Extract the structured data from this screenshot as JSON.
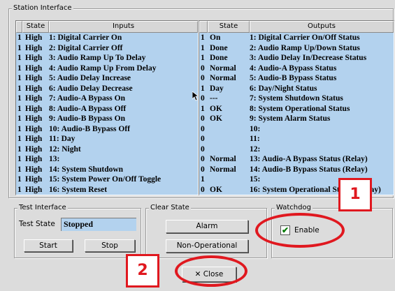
{
  "station": {
    "title": "Station Interface",
    "inputs": {
      "headers": [
        "State",
        "Inputs"
      ],
      "rows": [
        [
          "1",
          "High",
          "1: Digital Carrier On"
        ],
        [
          "1",
          "High",
          "2: Digital Carrier Off"
        ],
        [
          "1",
          "High",
          "3: Audio Ramp Up To Delay"
        ],
        [
          "1",
          "High",
          "4: Audio Ramp Up From Delay"
        ],
        [
          "1",
          "High",
          "5: Audio Delay Increase"
        ],
        [
          "1",
          "High",
          "6: Audio Delay Decrease"
        ],
        [
          "1",
          "High",
          "7: Audio-A Bypass On"
        ],
        [
          "1",
          "High",
          "8: Audio-A Bypass Off"
        ],
        [
          "1",
          "High",
          "9: Audio-B Bypass On"
        ],
        [
          "1",
          "High",
          "10: Audio-B Bypass Off"
        ],
        [
          "1",
          "High",
          "11: Day"
        ],
        [
          "1",
          "High",
          "12: Night"
        ],
        [
          "1",
          "High",
          "13:"
        ],
        [
          "1",
          "High",
          "14: System Shutdown"
        ],
        [
          "1",
          "High",
          "15: System Power On/Off Toggle"
        ],
        [
          "1",
          "High",
          "16: System Reset"
        ]
      ]
    },
    "outputs": {
      "headers": [
        "State",
        "Outputs"
      ],
      "rows": [
        [
          "1",
          "On",
          "1: Digital Carrier On/Off Status"
        ],
        [
          "1",
          "Done",
          "2: Audio Ramp Up/Down Status"
        ],
        [
          "1",
          "Done",
          "3: Audio Delay In/Decrease Status"
        ],
        [
          "0",
          "Normal",
          "4: Audio-A Bypass Status"
        ],
        [
          "0",
          "Normal",
          "5: Audio-B Bypass Status"
        ],
        [
          "1",
          "Day",
          "6: Day/Night Status"
        ],
        [
          "0",
          "---",
          "7: System Shutdown Status"
        ],
        [
          "1",
          "OK",
          "8: System Operational Status"
        ],
        [
          "0",
          "OK",
          "9: System Alarm Status"
        ],
        [
          "0",
          "",
          "10:"
        ],
        [
          "0",
          "",
          "11:"
        ],
        [
          "0",
          "",
          "12:"
        ],
        [
          "0",
          "Normal",
          "13: Audio-A Bypass Status (Relay)"
        ],
        [
          "0",
          "Normal",
          "14: Audio-B Bypass Status (Relay)"
        ],
        [
          "1",
          "",
          "15:"
        ],
        [
          "0",
          "OK",
          "16: System Operational Status (Relay)"
        ]
      ]
    }
  },
  "test_interface": {
    "title": "Test Interface",
    "state_label": "Test State",
    "state_value": "Stopped",
    "start_label": "Start",
    "stop_label": "Stop"
  },
  "clear_state": {
    "title": "Clear State",
    "alarm_label": "Alarm",
    "non_operational_label": "Non-Operational"
  },
  "watchdog": {
    "title": "Watchdog",
    "enable_label": "Enable",
    "enabled": true
  },
  "close_label": "Close",
  "annotations": {
    "badge_1": "1",
    "badge_2": "2",
    "color": "#e0181f"
  },
  "icons": {
    "check": "check-icon",
    "close": "x-close-icon"
  }
}
